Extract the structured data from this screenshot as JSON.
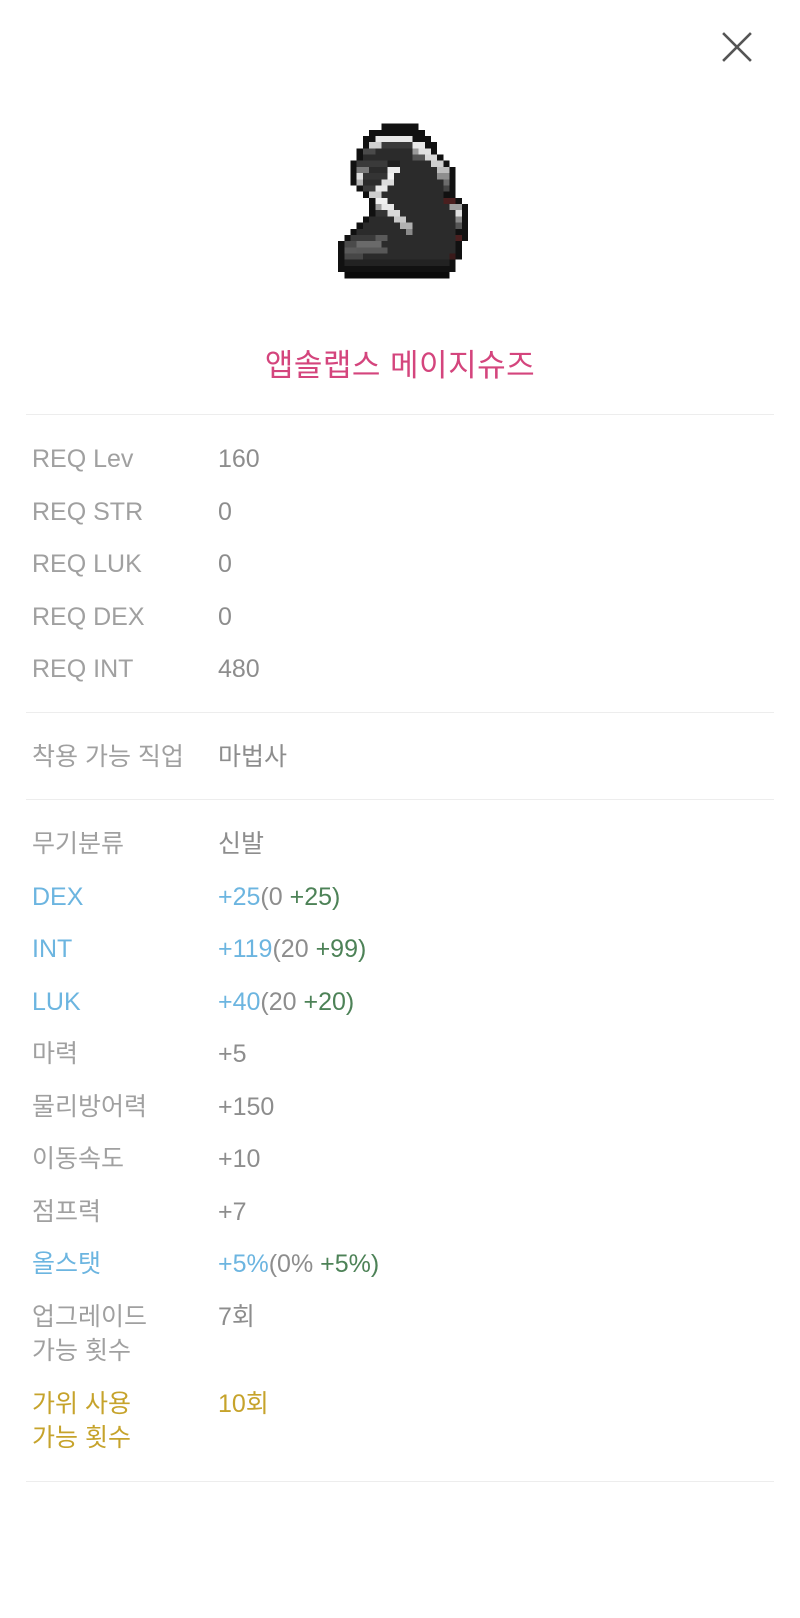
{
  "header": {
    "close_icon": "close-icon",
    "close_label": "닫기"
  },
  "item": {
    "image_icon": "item-sprite-boots",
    "name": "앱솔랩스 메이지슈즈",
    "name_color": "#d4457d"
  },
  "colors": {
    "label_gray": "#a0a0a0",
    "value_gray": "#8d8d8d",
    "accent_blue": "#6cb5e0",
    "bonus_green": "#4d8257",
    "gold": "#c6a32b",
    "title_pink": "#d4457d",
    "divider": "#ededed"
  },
  "sections": [
    {
      "id": "requirements",
      "rows": [
        {
          "label": "REQ Lev",
          "value": "160"
        },
        {
          "label": "REQ STR",
          "value": "0"
        },
        {
          "label": "REQ LUK",
          "value": "0"
        },
        {
          "label": "REQ DEX",
          "value": "0"
        },
        {
          "label": "REQ INT",
          "value": "480"
        }
      ]
    },
    {
      "id": "job",
      "rows": [
        {
          "label": "착용 가능 직업",
          "value": "마법사"
        }
      ]
    },
    {
      "id": "stats",
      "rows": [
        {
          "label": "무기분류",
          "value": "신발"
        },
        {
          "label": "DEX",
          "base": "+25",
          "paren": "(0 ",
          "bonus": "+25)"
        },
        {
          "label": "INT",
          "base": "+119",
          "paren": "(20 ",
          "bonus": "+99)"
        },
        {
          "label": "LUK",
          "base": "+40",
          "paren": "(20 ",
          "bonus": "+20)"
        },
        {
          "label": "마력",
          "value": "+5"
        },
        {
          "label": "물리방어력",
          "value": "+150"
        },
        {
          "label": "이동속도",
          "value": "+10"
        },
        {
          "label": "점프력",
          "value": "+7"
        },
        {
          "label": "올스탯",
          "base": "+5%",
          "paren": "(0% ",
          "bonus": "+5%)"
        },
        {
          "label": "업그레이드\n가능 횟수",
          "value": "7회"
        },
        {
          "label": "가위 사용\n가능 횟수",
          "value": "10회"
        }
      ]
    }
  ]
}
